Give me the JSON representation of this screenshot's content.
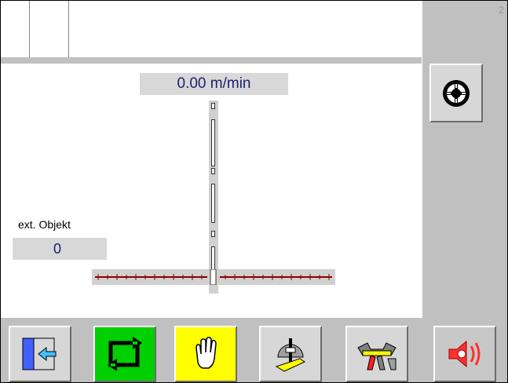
{
  "header": {
    "page_number": "2"
  },
  "speed": {
    "value": "0.00 m/min"
  },
  "ext_object": {
    "label": "ext. Objekt",
    "value": "0"
  },
  "toolbar": {
    "buttons": [
      {
        "name": "exit-icon",
        "state": "normal"
      },
      {
        "name": "cycle-icon",
        "state": "active-green"
      },
      {
        "name": "hand-icon",
        "state": "active-yellow"
      },
      {
        "name": "brush-icon",
        "state": "normal"
      },
      {
        "name": "tools-icon",
        "state": "normal"
      },
      {
        "name": "speaker-icon",
        "state": "disabled"
      }
    ]
  },
  "colors": {
    "active_green": "#00d000",
    "active_yellow": "#ffff00",
    "panel_gray": "#c0c0c0",
    "value_text": "#202070",
    "scale_red": "#8b0000"
  }
}
